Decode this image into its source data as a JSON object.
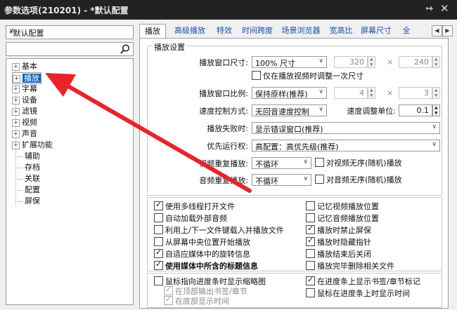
{
  "window": {
    "title": "参数选项(210201) - *默认配置",
    "pin_icon": "pin-icon",
    "close_icon": "close-icon"
  },
  "sidebar": {
    "profile": "*默认配置",
    "search": {
      "value": "",
      "placeholder": ""
    },
    "items": [
      {
        "label": "基本",
        "expandable": true
      },
      {
        "label": "播放",
        "expandable": true,
        "selected": true
      },
      {
        "label": "字幕",
        "expandable": true
      },
      {
        "label": "设备",
        "expandable": true
      },
      {
        "label": "滤镜",
        "expandable": true
      },
      {
        "label": "视频",
        "expandable": true
      },
      {
        "label": "声音",
        "expandable": true
      },
      {
        "label": "扩展功能",
        "expandable": true
      },
      {
        "label": "辅助",
        "expandable": false
      },
      {
        "label": "存档",
        "expandable": false
      },
      {
        "label": "关联",
        "expandable": false
      },
      {
        "label": "配置",
        "expandable": false
      },
      {
        "label": "屏保",
        "expandable": false
      }
    ]
  },
  "tabs": [
    "播放",
    "高级播放",
    "特效",
    "时间跨度",
    "场景浏览器",
    "宽高比",
    "屏幕尺寸",
    "全"
  ],
  "playback": {
    "group_title": "播放设置",
    "window_size": {
      "label": "播放窗口尺寸:",
      "value": "100% 尺寸",
      "width": "320",
      "height": "240",
      "sep": "×"
    },
    "adjust_once": {
      "label": "仅在播放视频时调整一次尺寸",
      "checked": false
    },
    "aspect": {
      "label": "播放窗口比例:",
      "value": "保持原样(推荐)",
      "w": "4",
      "h": "3",
      "sep": "×"
    },
    "speed": {
      "label": "速度控制方式:",
      "value": "无回音速度控制",
      "unit_label": "速度调整单位:",
      "unit_value": "0.1"
    },
    "failure": {
      "label": "播放失败时:",
      "value": "显示错误窗口(推荐)"
    },
    "priority": {
      "label": "优先运行权:",
      "value": "高配置：高优先级(推荐)"
    },
    "video_repeat": {
      "label": "视频重复播放:",
      "value": "不循环",
      "random_label": "对视频无序(随机)播放",
      "checked": false
    },
    "audio_repeat": {
      "label": "音频重复播放:",
      "value": "不循环",
      "random_label": "对音频无序(随机)播放",
      "checked": false
    }
  },
  "options_left": [
    {
      "label": "使用多线程打开文件",
      "checked": true
    },
    {
      "label": "自动加载外部音频",
      "checked": false
    },
    {
      "label": "利用上/下一文件键载入并播放文件",
      "checked": false
    },
    {
      "label": "从屏幕中央位置开始播放",
      "checked": false
    },
    {
      "label": "自适应媒体中的旋转信息",
      "checked": true
    },
    {
      "label": "使用媒体中所含的标题信息",
      "checked": true,
      "bold": true
    }
  ],
  "options_right": [
    {
      "label": "记忆视频播放位置",
      "checked": false
    },
    {
      "label": "记忆音频播放位置",
      "checked": false
    },
    {
      "label": "播放时禁止屏保",
      "checked": true
    },
    {
      "label": "播放时隐藏指针",
      "checked": true
    },
    {
      "label": "播放结束后关闭",
      "checked": false
    },
    {
      "label": "播放完毕删除相关文件",
      "checked": false
    }
  ],
  "thumb_left": [
    {
      "label": "鼠标指向进度条时显示缩略图",
      "checked": false,
      "disabled": false
    },
    {
      "label": "在顶部输出书签/章节",
      "checked": true,
      "disabled": true
    },
    {
      "label": "在底部显示时间",
      "checked": true,
      "disabled": true
    }
  ],
  "thumb_right": [
    {
      "label": "在进度条上显示书签/章节标记",
      "checked": true
    },
    {
      "label": "鼠标在进度条上时显示时间",
      "checked": false
    }
  ],
  "annotation": {
    "color": "#e8232a"
  }
}
